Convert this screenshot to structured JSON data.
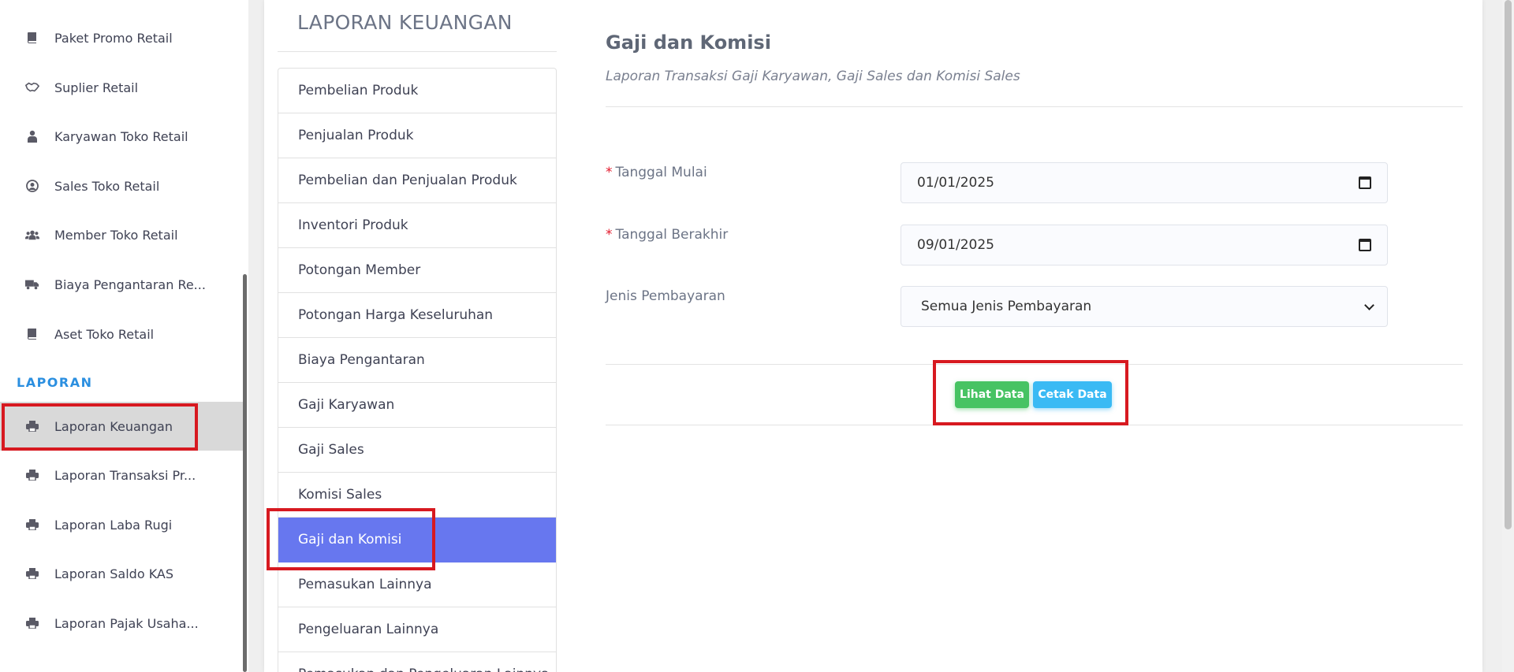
{
  "sidebar": {
    "items": [
      {
        "label": "Paket Promo Retail",
        "icon": "book-icon"
      },
      {
        "label": "Suplier Retail",
        "icon": "handshake-icon"
      },
      {
        "label": "Karyawan Toko Retail",
        "icon": "user-tie-icon"
      },
      {
        "label": "Sales Toko Retail",
        "icon": "user-circle-icon"
      },
      {
        "label": "Member Toko Retail",
        "icon": "users-icon"
      },
      {
        "label": "Biaya Pengantaran Re...",
        "icon": "truck-icon"
      },
      {
        "label": "Aset Toko Retail",
        "icon": "book-icon"
      }
    ],
    "heading": "LAPORAN",
    "report_items": [
      {
        "label": "Laporan Keuangan",
        "icon": "print-icon",
        "active": true
      },
      {
        "label": "Laporan Transaksi Pr...",
        "icon": "print-icon"
      },
      {
        "label": "Laporan Laba Rugi",
        "icon": "print-icon"
      },
      {
        "label": "Laporan Saldo KAS",
        "icon": "print-icon"
      },
      {
        "label": "Laporan Pajak Usaha...",
        "icon": "print-icon"
      }
    ]
  },
  "report_menu": {
    "title": "LAPORAN KEUANGAN",
    "items": [
      "Pembelian Produk",
      "Penjualan Produk",
      "Pembelian dan Penjualan Produk",
      "Inventori Produk",
      "Potongan Member",
      "Potongan Harga Keseluruhan",
      "Biaya Pengantaran",
      "Gaji Karyawan",
      "Gaji Sales",
      "Komisi Sales",
      "Gaji dan Komisi",
      "Pemasukan Lainnya",
      "Pengeluaran Lainnya",
      "Pemasukan dan Pengeluaran Lainnya"
    ],
    "active": "Gaji dan Komisi"
  },
  "content": {
    "title": "Gaji dan Komisi",
    "subtitle": "Laporan Transaksi Gaji Karyawan, Gaji Sales dan Komisi Sales",
    "form": {
      "start_label": "Tanggal Mulai",
      "start_value": "01/01/2025",
      "end_label": "Tanggal Berakhir",
      "end_value": "09/01/2025",
      "payment_label": "Jenis Pembayaran",
      "payment_value": "Semua Jenis Pembayaran",
      "required_mark": "*"
    },
    "buttons": {
      "view": "Lihat Data",
      "print": "Cetak Data"
    }
  },
  "colors": {
    "accent": "#6777ef",
    "success": "#47c363",
    "info": "#3abaf4",
    "highlight": "#d71920",
    "heading": "#2b8fe0"
  }
}
